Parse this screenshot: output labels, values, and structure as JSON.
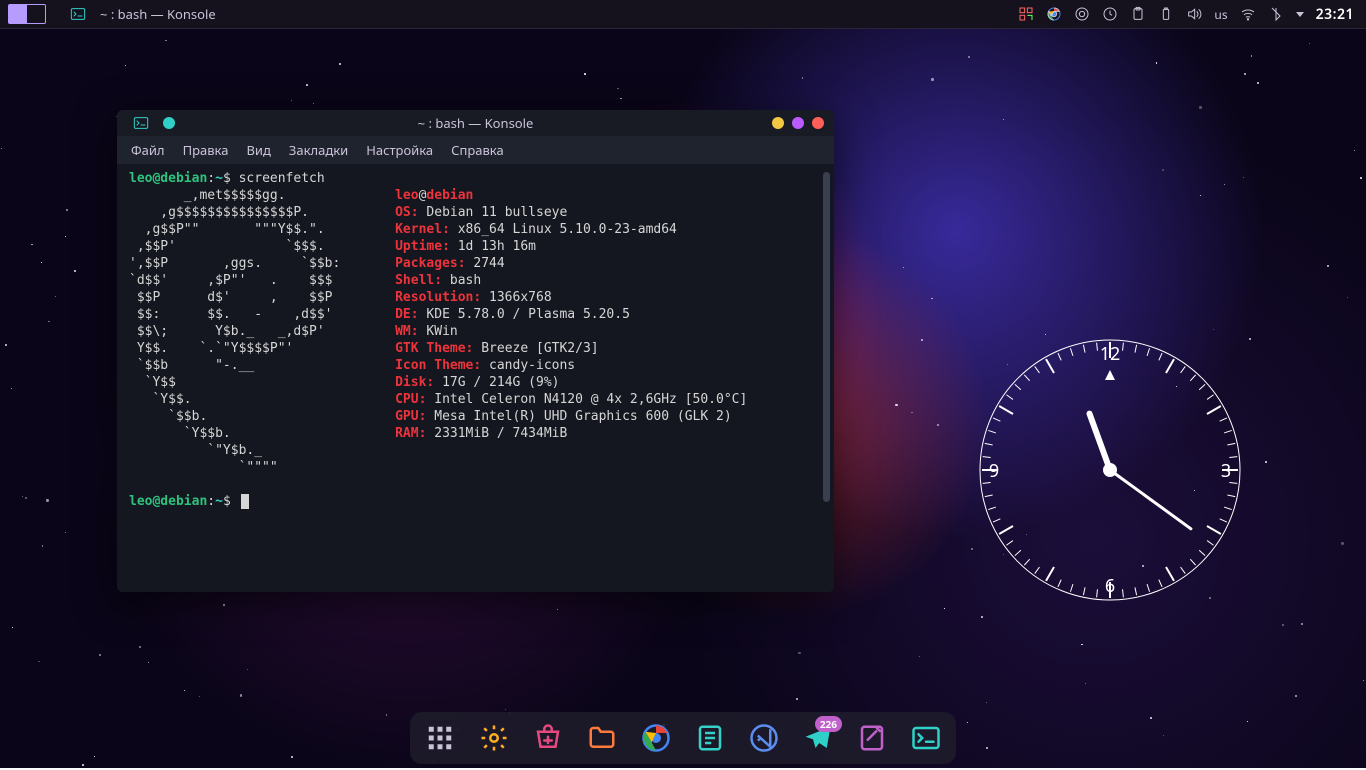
{
  "colors": {
    "accent": "#b79cff",
    "term_green": "#2ec27e",
    "term_cyan": "#2fd0c8",
    "term_red": "#ed333b",
    "term_fg": "#d6d6d6"
  },
  "panel": {
    "task_title": "~ : bash — Konsole",
    "kb_layout": "us",
    "clock": "23:21"
  },
  "window": {
    "title": "~ : bash — Konsole",
    "menus": [
      "Файл",
      "Правка",
      "Вид",
      "Закладки",
      "Настройка",
      "Справка"
    ]
  },
  "prompt": {
    "user": "leo",
    "host": "debian",
    "cwd": "~",
    "symbol": "$",
    "command": "screenfetch"
  },
  "ascii_art": [
    "       _,met$$$$$gg.",
    "    ,g$$$$$$$$$$$$$$$P.",
    "  ,g$$P\"\"       \"\"\"Y$$.\".",
    " ,$$P'              `$$$.",
    "',$$P       ,ggs.     `$$b:",
    "`d$$'     ,$P\"'   .    $$$",
    " $$P      d$'     ,    $$P",
    " $$:      $$.   -    ,d$$'",
    " $$\\;      Y$b._   _,d$P'",
    " Y$$.    `.`\"Y$$$$P\"'",
    " `$$b      \"-.__",
    "  `Y$$",
    "   `Y$$.",
    "     `$$b.",
    "       `Y$$b.",
    "          `\"Y$b._",
    "              `\"\"\"\""
  ],
  "info_lines": [
    {
      "key": "",
      "value": "leo@debian",
      "userhost": true
    },
    {
      "key": "OS:",
      "value": "Debian 11 bullseye"
    },
    {
      "key": "Kernel:",
      "value": "x86_64 Linux 5.10.0-23-amd64"
    },
    {
      "key": "Uptime:",
      "value": "1d 13h 16m"
    },
    {
      "key": "Packages:",
      "value": "2744"
    },
    {
      "key": "Shell:",
      "value": "bash"
    },
    {
      "key": "Resolution:",
      "value": "1366x768"
    },
    {
      "key": "DE:",
      "value": "KDE 5.78.0 / Plasma 5.20.5"
    },
    {
      "key": "WM:",
      "value": "KWin"
    },
    {
      "key": "GTK Theme:",
      "value": "Breeze [GTK2/3]"
    },
    {
      "key": "Icon Theme:",
      "value": "candy-icons"
    },
    {
      "key": "Disk:",
      "value": "17G / 214G (9%)"
    },
    {
      "key": "CPU:",
      "value": "Intel Celeron N4120 @ 4x 2,6GHz [50.0°C]"
    },
    {
      "key": "GPU:",
      "value": "Mesa Intel(R) UHD Graphics 600 (GLK 2)"
    },
    {
      "key": "RAM:",
      "value": "2331MiB / 7434MiB"
    }
  ],
  "dock": {
    "items": [
      {
        "name": "app-launcher"
      },
      {
        "name": "settings"
      },
      {
        "name": "software-center"
      },
      {
        "name": "file-manager"
      },
      {
        "name": "chrome"
      },
      {
        "name": "text-editor"
      },
      {
        "name": "vscode"
      },
      {
        "name": "telegram",
        "badge": "226"
      },
      {
        "name": "notes"
      },
      {
        "name": "konsole"
      }
    ]
  },
  "analog_clock": {
    "numerals": {
      "12": "12",
      "3": "3",
      "6": "6",
      "9": "9"
    },
    "hour_angle": 340,
    "minute_angle": 126
  }
}
